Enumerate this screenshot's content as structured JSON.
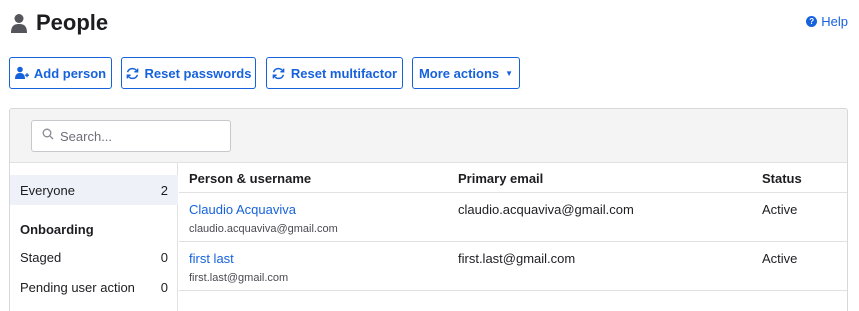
{
  "header": {
    "title": "People",
    "help_label": "Help"
  },
  "toolbar": {
    "add_person": "Add person",
    "reset_passwords": "Reset passwords",
    "reset_multifactor": "Reset multifactor",
    "more_actions": "More actions"
  },
  "search": {
    "placeholder": "Search..."
  },
  "sidebar": {
    "items": [
      {
        "label": "Everyone",
        "count": "2"
      }
    ],
    "group_heading": "Onboarding",
    "group_items": [
      {
        "label": "Staged",
        "count": "0"
      },
      {
        "label": "Pending user action",
        "count": "0"
      }
    ]
  },
  "table": {
    "columns": [
      "Person & username",
      "Primary email",
      "Status"
    ],
    "rows": [
      {
        "name": "Claudio Acquaviva",
        "username": "claudio.acquaviva@gmail.com",
        "email": "claudio.acquaviva@gmail.com",
        "status": "Active"
      },
      {
        "name": "first last",
        "username": "first.last@gmail.com",
        "email": "first.last@gmail.com",
        "status": "Active"
      }
    ]
  },
  "colors": {
    "accent": "#1662dd",
    "panel_header": "#f4f4f4",
    "active_row": "#eef1f8"
  },
  "icons": [
    "person-icon",
    "help-icon",
    "add-person-icon",
    "refresh-icon",
    "caret-down-icon",
    "search-icon"
  ]
}
